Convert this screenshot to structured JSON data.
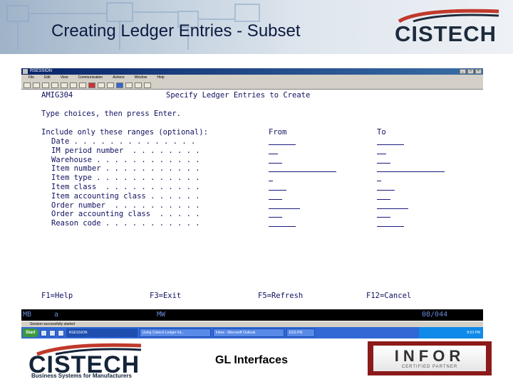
{
  "slide": {
    "title": "Creating Ledger Entries - Subset",
    "caption": "GL Interfaces"
  },
  "logos": {
    "cistech_top": "CISTECH",
    "cistech_bottom": "CISTECH",
    "cistech_tagline": "Business Systems for Manufacturers",
    "infor_brand": "INFOR",
    "infor_cert": "CERTIFIED PARTNER"
  },
  "window": {
    "title": "RSESSION",
    "menu": [
      "File",
      "Edit",
      "View",
      "Communication",
      "Actions",
      "Window",
      "Help"
    ]
  },
  "screen": {
    "program_id": "AMIG304",
    "heading": "Specify Ledger Entries to Create",
    "instruction": "Type choices, then press Enter.",
    "ranges_label": "Include only these ranges (optional):",
    "col_from": "From",
    "col_to": "To",
    "rows": [
      {
        "label": "Date . . . . . . . . . . . . . .",
        "from_len": 6,
        "to_len": 6
      },
      {
        "label": "IM period number  . . . . . . . .",
        "from_len": 2,
        "to_len": 2
      },
      {
        "label": "Warehouse . . . . . . . . . . . .",
        "from_len": 3,
        "to_len": 3
      },
      {
        "label": "Item number . . . . . . . . . . .",
        "from_len": 15,
        "to_len": 15
      },
      {
        "label": "Item type . . . . . . . . . . . .",
        "from_len": 1,
        "to_len": 1
      },
      {
        "label": "Item class  . . . . . . . . . . .",
        "from_len": 4,
        "to_len": 4
      },
      {
        "label": "Item accounting class . . . . . .",
        "from_len": 3,
        "to_len": 3
      },
      {
        "label": "Order number  . . . . . . . . . .",
        "from_len": 7,
        "to_len": 7
      },
      {
        "label": "Order accounting class  . . . . .",
        "from_len": 3,
        "to_len": 3
      },
      {
        "label": "Reason code . . . . . . . . . . .",
        "from_len": 6,
        "to_len": 6
      }
    ],
    "fkeys": [
      "F1=Help",
      "F3=Exit",
      "F5=Refresh",
      "F12=Cancel"
    ]
  },
  "oia": {
    "left": "MB",
    "mode": "a",
    "mw": "MW",
    "cursor": "08/044"
  },
  "statusbar": {
    "text": "Session successfully started"
  },
  "taskbar": {
    "start": "Start",
    "tasks": [
      "RSESSION",
      "Using Cistech Ledger Int...",
      "Inbox - Microsoft Outlook",
      "ESS Pt5"
    ],
    "clock": "8:53 PM"
  }
}
